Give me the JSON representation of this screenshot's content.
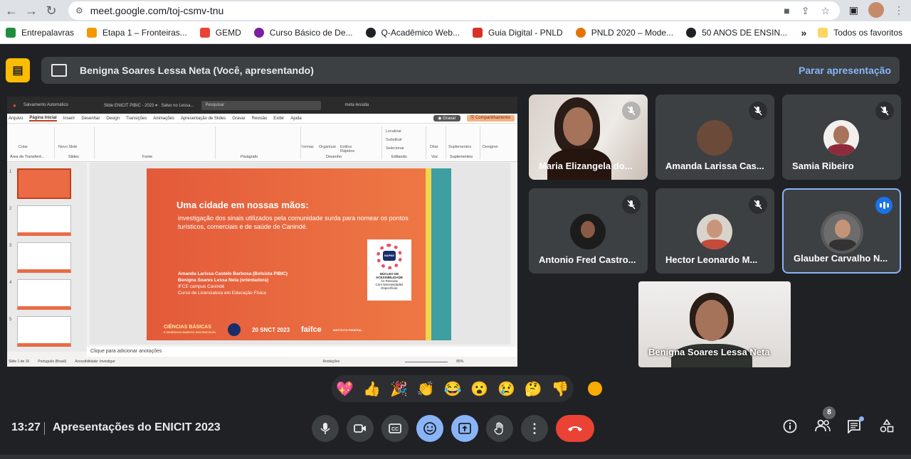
{
  "browser": {
    "url": "meet.google.com/toj-csmv-tnu",
    "bookmarks": [
      {
        "label": "Entrepalavras",
        "color": "#1e8e3e"
      },
      {
        "label": "Etapa 1 – Fronteiras...",
        "color": "#f29900"
      },
      {
        "label": "GEMD",
        "color": "#ea4335"
      },
      {
        "label": "Curso Básico de De...",
        "color": "#7b1fa2"
      },
      {
        "label": "Q-Acadêmico Web...",
        "color": "#202124"
      },
      {
        "label": "Guia Digital - PNLD",
        "color": "#d93025"
      },
      {
        "label": "PNLD 2020 – Mode...",
        "color": "#e37400"
      },
      {
        "label": "50 ANOS DE ENSIN...",
        "color": "#202124"
      }
    ],
    "more_label": "»",
    "all_favorites": "Todos os favoritos"
  },
  "presenting": {
    "label": "Benigna Soares Lessa Neta (Você, apresentando)",
    "stop_label": "Parar apresentação"
  },
  "ppt": {
    "autosave": "Salvamento Automático",
    "doc_title": "Slide ENICIT PIBIC - 2023 ▾ · Salvo no Lessa...",
    "search": "Pesquisar",
    "user": "meta lessida",
    "menu": [
      "Arquivo",
      "Página Inicial",
      "Inserir",
      "Desenhar",
      "Design",
      "Transições",
      "Animações",
      "Apresentação de Slides",
      "Gravar",
      "Revisão",
      "Exibir",
      "Ajuda"
    ],
    "record": "◉ Gravar",
    "share": "⎘ Compartilhamento",
    "ribbon_groups": [
      "Área de Transferê...",
      "Slides",
      "Fonte",
      "Parágrafo",
      "Desenho",
      "Editando",
      "Voz",
      "Suplementos"
    ],
    "ribbon_buttons": [
      "Colar",
      "Novo Slide",
      "Formas",
      "Organizar",
      "Estilos Rápidos",
      "Localizar",
      "Substituir",
      "Selecionar",
      "Ditar",
      "Suplementos",
      "Designer"
    ],
    "notes": "Clique para adicionar anotações",
    "status_slide": "Slide 1 de 16",
    "status_lang": "Português (Brasil)",
    "status_access": "Acessibilidade: Investigar",
    "status_notes": "Anotações",
    "status_zoom": "85%",
    "thumb_nums": [
      "1",
      "2",
      "3",
      "4",
      "5"
    ]
  },
  "slide": {
    "title": "Uma cidade em nossas mãos:",
    "subtitle": "investigação dos sinais utilizados pela comunidade surda para nomear os pontos turísticos, comerciais e de saúde de Canindé.",
    "author1": "Amanda Larissa Castelo Barbosa (Bolsista PIBIC)",
    "author2": "Benigna Soares Lessa Neta (orientadora)",
    "inst1": "IFCE campus Canindé",
    "inst2": "Curso de Licenciatura em Educação Física",
    "logo_main": "NAPNE",
    "logo_text1": "NÚCLEO DE",
    "logo_text2": "ACESSIBILIDADE",
    "logo_text3": "Às Pessoas",
    "logo_text4": "Com Necessidades",
    "logo_text5": "Específicas",
    "foot_cb1": "CIÊNCIAS BÁSICAS",
    "foot_cb2": "E DESENVOLVIMENTO SUSTENTÁVEL",
    "foot_snct": "20 SNCT 2023",
    "foot_faifce": "faifce",
    "foot_if": "INSTITUTO FEDERAL"
  },
  "participants": [
    {
      "name": "Maria Elizangela do...",
      "muted": true
    },
    {
      "name": "Amanda Larissa Cas...",
      "muted": true
    },
    {
      "name": "Samia Ribeiro",
      "muted": true
    },
    {
      "name": "Antonio Fred Castro...",
      "muted": true
    },
    {
      "name": "Hector Leonardo M...",
      "muted": true
    },
    {
      "name": "Glauber Carvalho N...",
      "muted": false,
      "speaking": true
    }
  ],
  "self": {
    "name": "Benigna Soares Lessa Neta"
  },
  "reactions": [
    "💖",
    "👍",
    "🎉",
    "👏",
    "😂",
    "😮",
    "😢",
    "🤔",
    "👎"
  ],
  "bottom": {
    "time": "13:27",
    "meeting": "Apresentações do ENICIT 2023",
    "participant_count": "8"
  },
  "colors": {
    "accent": "#8ab4f8",
    "end_call": "#ea4335",
    "presenting_badge": "#fbbc04"
  }
}
